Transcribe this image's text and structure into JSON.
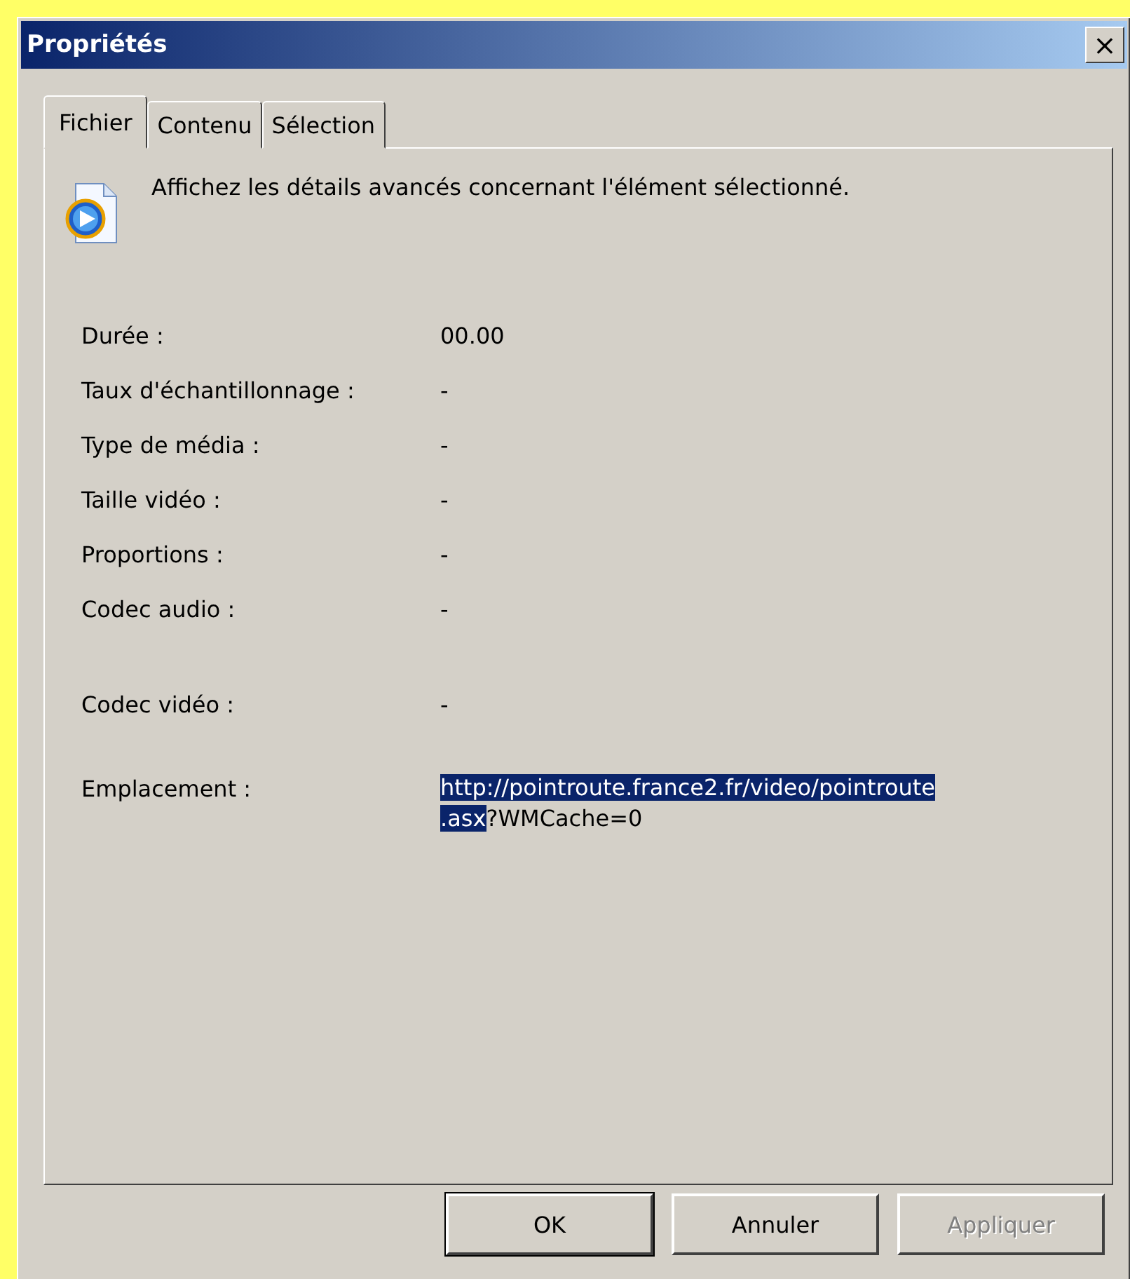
{
  "window": {
    "title": "Propriétés",
    "close": "×"
  },
  "tabs": [
    {
      "label": "Fichier",
      "selected": true
    },
    {
      "label": "Contenu",
      "selected": false
    },
    {
      "label": "Sélection",
      "selected": false
    }
  ],
  "description": "Affichez les détails avancés concernant l'élément sélectionné.",
  "properties": [
    {
      "label": "Durée :",
      "value": "00.00"
    },
    {
      "label": "Taux d'échantillonnage :",
      "value": "-"
    },
    {
      "label": "Type de média :",
      "value": "-"
    },
    {
      "label": "Taille vidéo :",
      "value": "-"
    },
    {
      "label": "Proportions :",
      "value": "-"
    },
    {
      "label": "Codec audio :",
      "value": "-"
    },
    {
      "label": "Codec vidéo :",
      "value": "-"
    }
  ],
  "location": {
    "label": "Emplacement :",
    "lines": [
      [
        {
          "text": "http://pointroute.france2.fr/video/pointroute",
          "selected": true
        }
      ],
      [
        {
          "text": ".asx",
          "selected": true
        },
        {
          "text": "?WMCache=0",
          "selected": false
        }
      ]
    ]
  },
  "buttons": [
    {
      "label": "OK",
      "default": true,
      "disabled": false
    },
    {
      "label": "Annuler",
      "default": false,
      "disabled": false
    },
    {
      "label": "Appliquer",
      "default": false,
      "disabled": true
    }
  ]
}
